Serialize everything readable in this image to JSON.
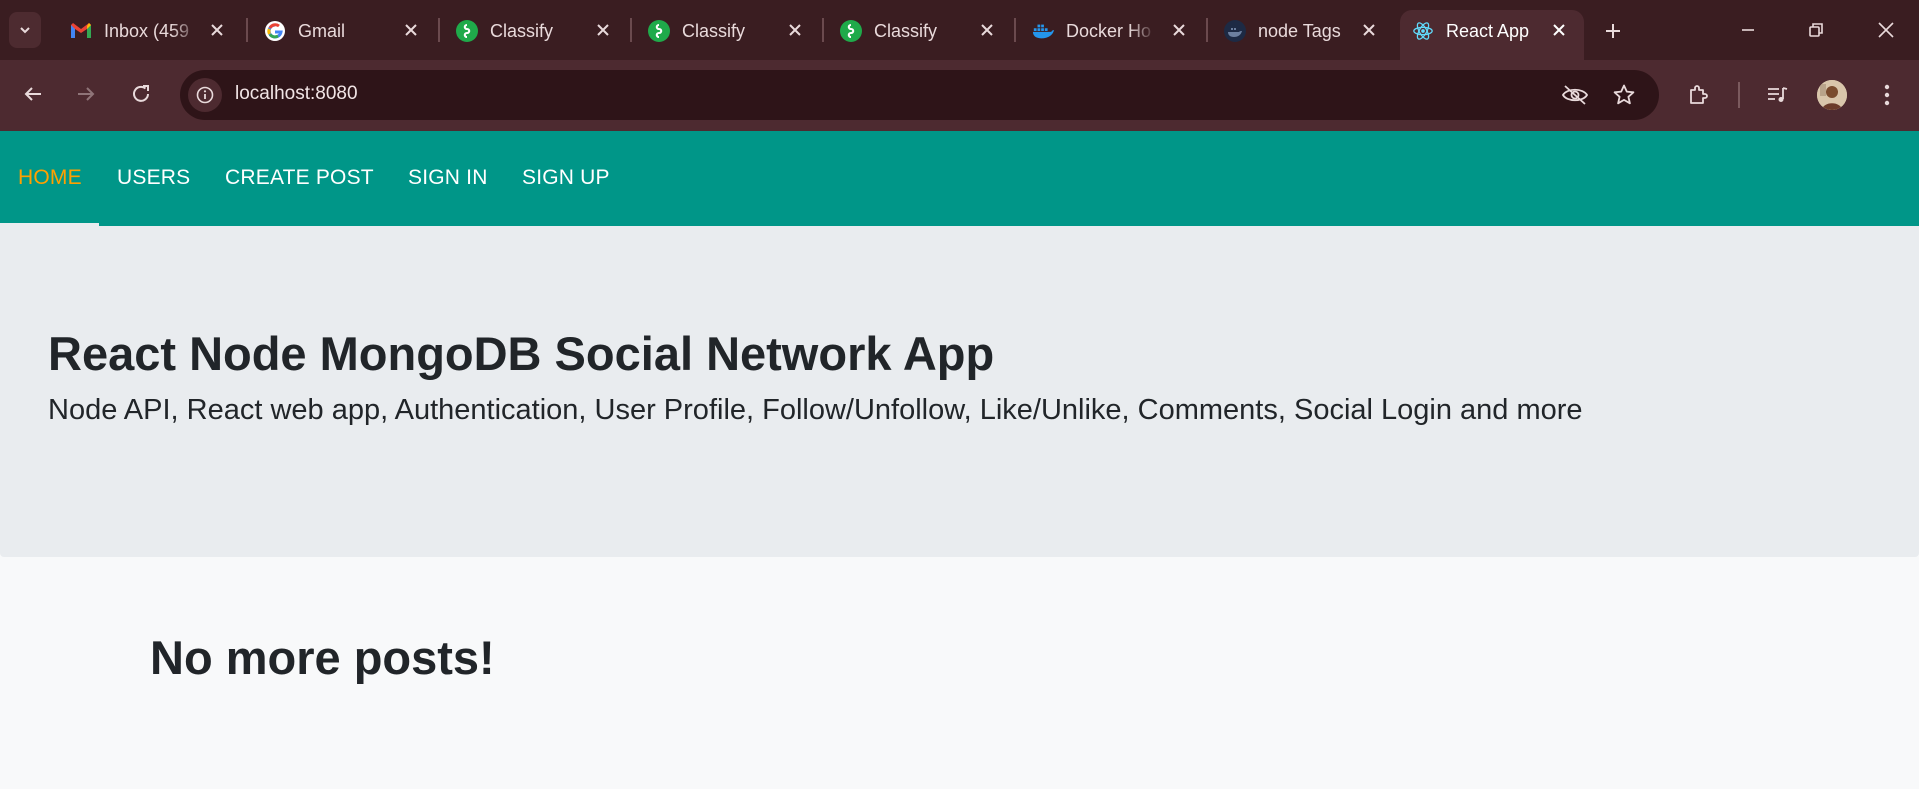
{
  "browser": {
    "tabs": [
      {
        "title": "Inbox (459",
        "icon": "gmail-icon"
      },
      {
        "title": "Gmail",
        "icon": "google-icon"
      },
      {
        "title": "Classify",
        "icon": "classify-icon"
      },
      {
        "title": "Classify",
        "icon": "classify-icon"
      },
      {
        "title": "Classify",
        "icon": "classify-icon"
      },
      {
        "title": "Docker Ho",
        "icon": "docker-icon"
      },
      {
        "title": "node Tags",
        "icon": "docker-hub-icon"
      },
      {
        "title": "React App",
        "icon": "react-icon",
        "active": true
      }
    ],
    "url": "localhost:8080"
  },
  "app": {
    "nav": {
      "home": "HOME",
      "users": "USERS",
      "create_post": "CREATE POST",
      "sign_in": "SIGN IN",
      "sign_up": "SIGN UP"
    },
    "jumbotron": {
      "title": "React Node MongoDB Social Network App",
      "lead": "Node API, React web app, Authentication, User Profile, Follow/Unfollow, Like/Unlike, Comments, Social Login and more"
    },
    "posts_heading": "No more posts!"
  },
  "colors": {
    "navbar": "#009688",
    "nav_active": "#ffa000",
    "jumbotron": "#e9ecef",
    "tabstrip": "#3a1d21",
    "toolbar": "#4d2a30"
  }
}
